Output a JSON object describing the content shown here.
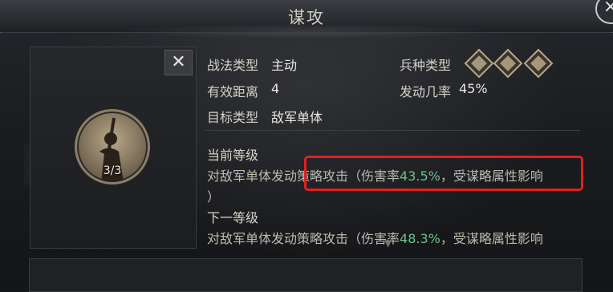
{
  "title": "谋攻",
  "skill": {
    "level": "3/3"
  },
  "info": {
    "type_label": "战法类型",
    "type_value": "主动",
    "distance_label": "有效距离",
    "distance_value": "4",
    "target_label": "目标类型",
    "target_value": "敌军单体",
    "troop_label": "兵种类型",
    "rate_label": "发动几率",
    "rate_value": "45%"
  },
  "current": {
    "heading": "当前等级",
    "text_a": "对敌军单体发动",
    "text_b": "策略攻击（伤害率",
    "pct": "43.5%",
    "text_c": "，受谋略属性影响",
    "text_d": "）"
  },
  "next": {
    "heading": "下一等级",
    "text_a": "对敌军单体发动策略攻击（伤害率",
    "pct": "48.3%",
    "text_c": "，受谋略属性影响"
  },
  "colors": {
    "accent": "#6fc28a",
    "highlight": "#e02020"
  },
  "icons": [
    "close-icon",
    "cavalry-icon",
    "shield-icon",
    "archer-icon"
  ]
}
